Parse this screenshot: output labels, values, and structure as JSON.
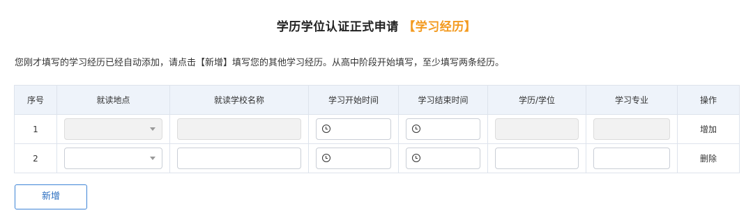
{
  "page": {
    "title_main": "学历学位认证正式申请",
    "title_accent": "【学习经历】",
    "notice": "您刚才填写的学习经历已经自动添加，请点击【新增】填写您的其他学习经历。从高中阶段开始填写，至少填写两条经历。"
  },
  "table": {
    "headers": [
      "序号",
      "就读地点",
      "就读学校名称",
      "学习开始时间",
      "学习结束时间",
      "学历/学位",
      "学习专业",
      "操作"
    ],
    "rows": [
      {
        "index": "1",
        "action": "增加",
        "disabled": true
      },
      {
        "index": "2",
        "action": "删除",
        "disabled": false
      }
    ]
  },
  "buttons": {
    "add": "新增"
  },
  "colors": {
    "accent": "#f39a1f",
    "header_bg": "#eef3fa",
    "button_border": "#3e84d6"
  }
}
